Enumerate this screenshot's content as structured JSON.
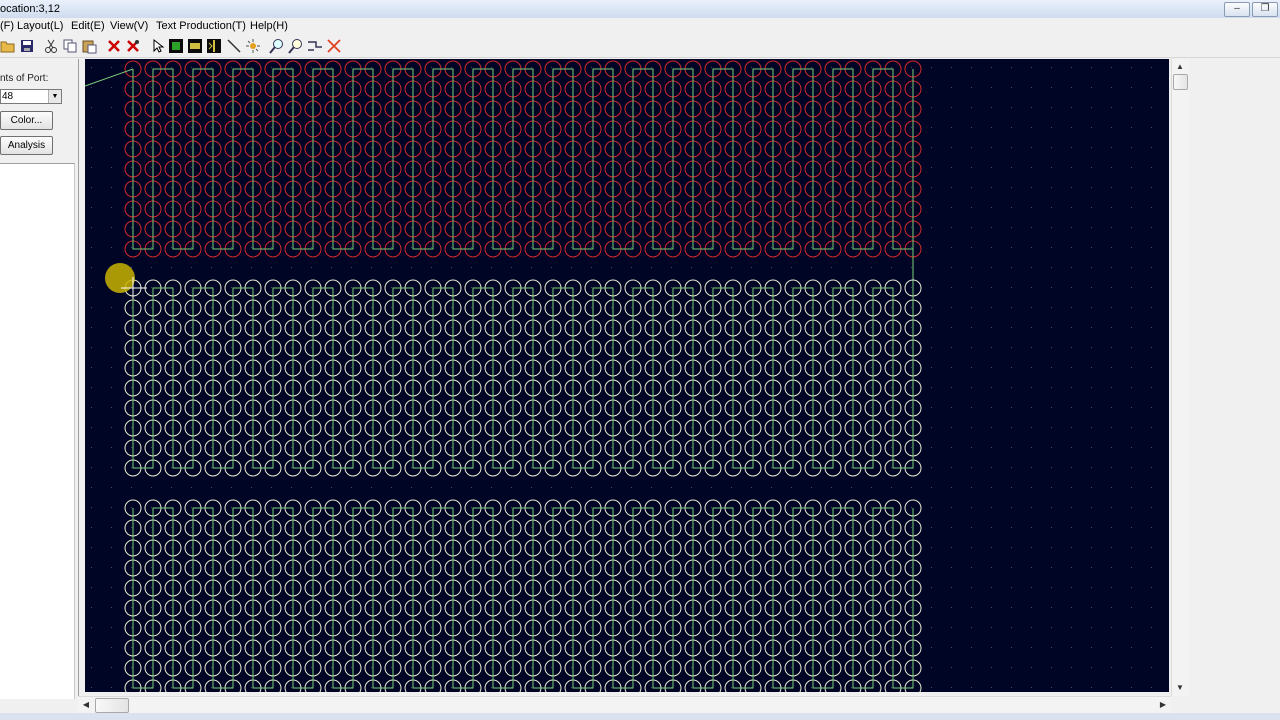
{
  "window": {
    "title": "ocation:3,12"
  },
  "menu": {
    "items": [
      "(F)",
      "Layout(L)",
      "Edit(E)",
      "View(V)",
      "Text Production(T)",
      "Help(H)"
    ]
  },
  "toolbar": {
    "icons": [
      "open-folder-icon",
      "save-icon",
      "cut-icon",
      "copy-icon",
      "paste-icon",
      "delete-icon",
      "delete-all-icon",
      "select-arrow-icon",
      "rectangle-icon",
      "fill-icon",
      "mirror-icon",
      "line-icon",
      "explode-icon",
      "zoom-in-icon",
      "zoom-out-icon",
      "zoom-fit-icon",
      "close-icon"
    ]
  },
  "panel": {
    "port_label": "nts of Port:",
    "port_value": "48",
    "color_button": "Color...",
    "analysis_button": "Analysis"
  },
  "canvas": {
    "background": "#000525",
    "grid_dot_color": "#3a4b6e",
    "red_circle_color": "#d42a2a",
    "white_circle_color": "#ececd2",
    "path_color": "#7ad17a",
    "cursor_highlight_color": "#c8b400"
  }
}
